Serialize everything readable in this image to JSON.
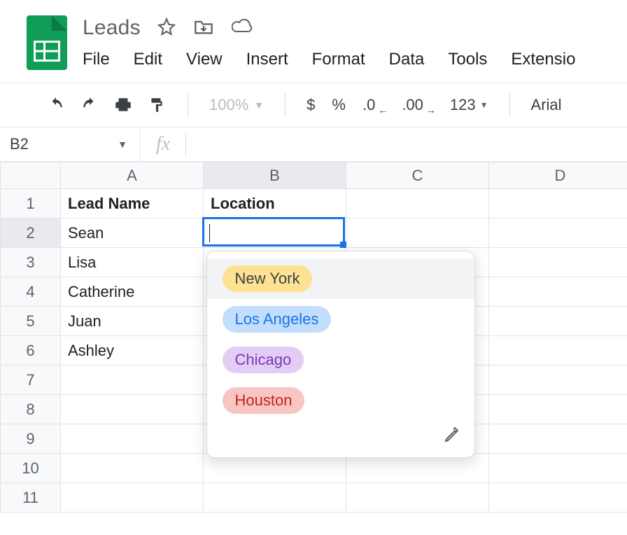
{
  "doc": {
    "title": "Leads"
  },
  "menu": {
    "file": "File",
    "edit": "Edit",
    "view": "View",
    "insert": "Insert",
    "format": "Format",
    "data": "Data",
    "tools": "Tools",
    "extensions": "Extensio"
  },
  "toolbar": {
    "zoom": "100%",
    "currency": "$",
    "percent": "%",
    "dec_dec": ".0",
    "dec_inc": ".00",
    "more_formats": "123",
    "font": "Arial"
  },
  "namebox": {
    "ref": "B2"
  },
  "formula": {
    "fx_label": "fx",
    "value": ""
  },
  "columns": [
    "A",
    "B",
    "C",
    "D"
  ],
  "rows": [
    "1",
    "2",
    "3",
    "4",
    "5",
    "6",
    "7",
    "8",
    "9",
    "10",
    "11"
  ],
  "active": {
    "row_index": 1,
    "col_index": 1
  },
  "data": {
    "headers": {
      "A": "Lead Name",
      "B": "Location"
    },
    "A": [
      "Sean",
      "Lisa",
      "Catherine",
      "Juan",
      "Ashley"
    ]
  },
  "dropdown": {
    "options": [
      {
        "label": "New York",
        "bg": "#fde293",
        "fg": "#3c4043"
      },
      {
        "label": "Los Angeles",
        "bg": "#c3defd",
        "fg": "#1a73e8"
      },
      {
        "label": "Chicago",
        "bg": "#e3cdf4",
        "fg": "#7b39bd"
      },
      {
        "label": "Houston",
        "bg": "#f7c5c2",
        "fg": "#c5221f"
      }
    ],
    "hover_index": 0
  }
}
